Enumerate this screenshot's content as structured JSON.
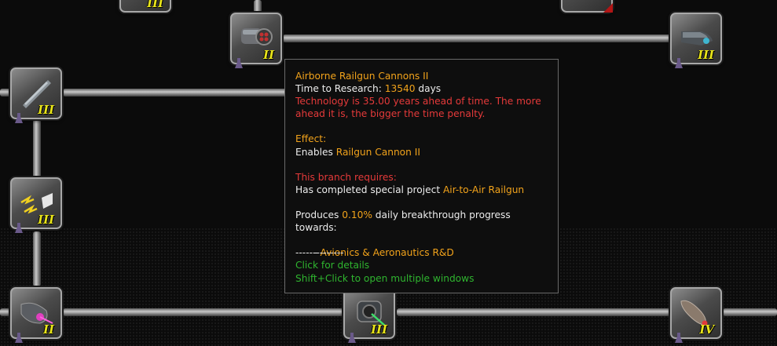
{
  "tree": {
    "nodes": [
      {
        "id": "top-left-partial",
        "tier": "III",
        "art": "partial"
      },
      {
        "id": "gatling",
        "tier": "II",
        "art": "cannon"
      },
      {
        "id": "top-right-partial",
        "tier": "",
        "art": "partial"
      },
      {
        "id": "pod-top-right",
        "tier": "III",
        "art": "pod"
      },
      {
        "id": "rail-rod",
        "tier": "III",
        "art": "rod"
      },
      {
        "id": "lightning",
        "tier": "III",
        "art": "lightning"
      },
      {
        "id": "laser-pod",
        "tier": "II",
        "art": "laser"
      },
      {
        "id": "turret",
        "tier": "III",
        "art": "turret"
      },
      {
        "id": "missile",
        "tier": "IV",
        "art": "missile"
      }
    ]
  },
  "tooltip": {
    "title": "Airborne Railgun Cannons II",
    "time_label": "Time to Research: ",
    "time_value": "13540",
    "time_unit": " days",
    "ahead_warning": "Technology is 35.00 years ahead of time. The more ahead it is, the bigger the time penalty.",
    "effect_label": "Effect:",
    "effect_prefix": "Enables ",
    "effect_item": "Railgun Cannon II",
    "branch_label": "This branch requires:",
    "branch_prefix": "Has completed special project ",
    "branch_item": "Air-to-Air Railgun",
    "produces_prefix": "Produces ",
    "produces_value": "0.10%",
    "produces_suffix": " daily breakthrough progress",
    "towards": "towards:",
    "target_bullet": "  - ",
    "target_item": "Avionics & Aeronautics R&D",
    "divider": "--------------",
    "hint_click": "Click for details",
    "hint_shift": "Shift+Click to open multiple windows"
  },
  "colors": {
    "highlight": "#f2a31b",
    "warning": "#e53a3a",
    "hint": "#2fb52f",
    "tier": "#e8e41a"
  }
}
